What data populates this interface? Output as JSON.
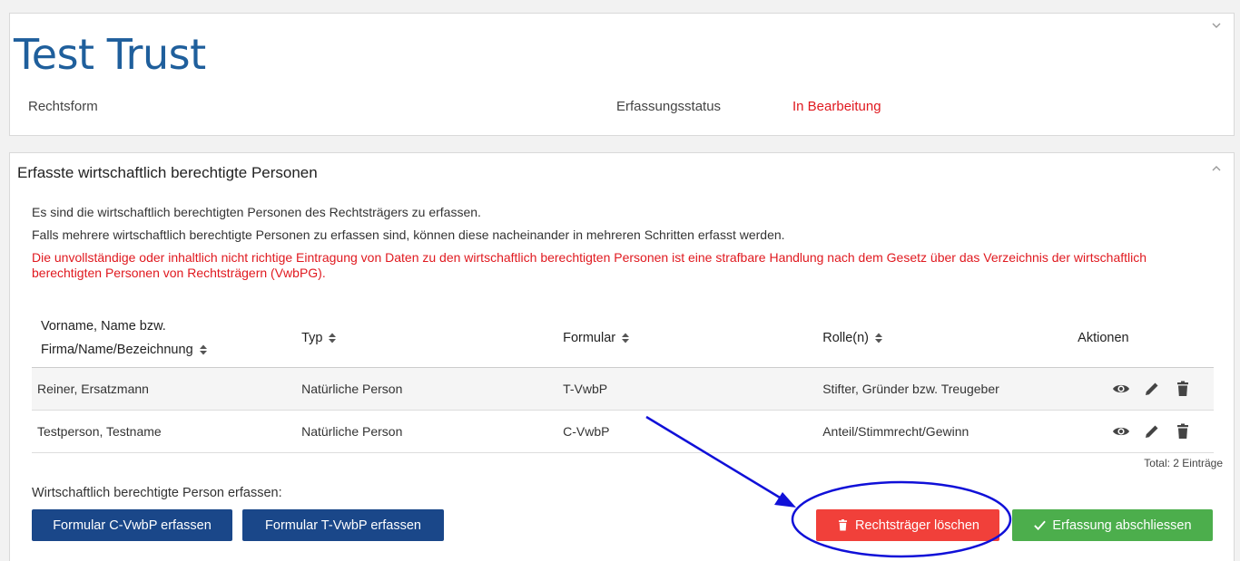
{
  "header": {
    "title": "Test Trust",
    "rechtsform_label": "Rechtsform",
    "status_label": "Erfassungsstatus",
    "status_value": "In Bearbeitung"
  },
  "section": {
    "title": "Erfasste wirtschaftlich berechtigte Personen",
    "intro_1": "Es sind die wirtschaftlich berechtigten Personen des Rechtsträgers zu erfassen.",
    "intro_2": "Falls mehrere wirtschaftlich berechtigte Personen zu erfassen sind, können diese nacheinander in mehreren Schritten erfasst werden.",
    "warning": "Die unvollständige oder inhaltlich nicht richtige Eintragung von Daten zu den wirtschaftlich berechtigten Personen ist eine strafbare Handlung nach dem Gesetz über das Verzeichnis der wirtschaftlich berechtigten Personen von Rechtsträgern (VwbPG)."
  },
  "table": {
    "columns": {
      "name_line1": "Vorname, Name bzw.",
      "name_line2": "Firma/Name/Bezeichnung",
      "typ": "Typ",
      "formular": "Formular",
      "rolle": "Rolle(n)",
      "aktionen": "Aktionen"
    },
    "rows": [
      {
        "name": "Reiner, Ersatzmann",
        "typ": "Natürliche Person",
        "formular": "T-VwbP",
        "rolle": "Stifter, Gründer bzw. Treugeber"
      },
      {
        "name": "Testperson, Testname",
        "typ": "Natürliche Person",
        "formular": "C-VwbP",
        "rolle": "Anteil/Stimmrecht/Gewinn"
      }
    ],
    "total": "Total: 2 Einträge"
  },
  "add": {
    "label": "Wirtschaftlich berechtigte Person erfassen:",
    "btn_c": "Formular C-VwbP erfassen",
    "btn_t": "Formular T-VwbP erfassen"
  },
  "footer_actions": {
    "delete_label": "Rechtsträger löschen",
    "finish_label": "Erfassung abschliessen"
  },
  "icons": {
    "view": "eye-icon",
    "edit": "pencil-icon",
    "delete": "trash-icon",
    "sort": "sort-icon",
    "collapse_top": "chevron-down-icon",
    "collapse_section": "chevron-up-icon",
    "check": "check-icon"
  },
  "colors": {
    "title_blue": "#1f5f9c",
    "status_red": "#e0191f",
    "primary_button": "#1a4789",
    "danger_button": "#f1403a",
    "success_button": "#4cae4c",
    "annotation": "#1010d8"
  }
}
